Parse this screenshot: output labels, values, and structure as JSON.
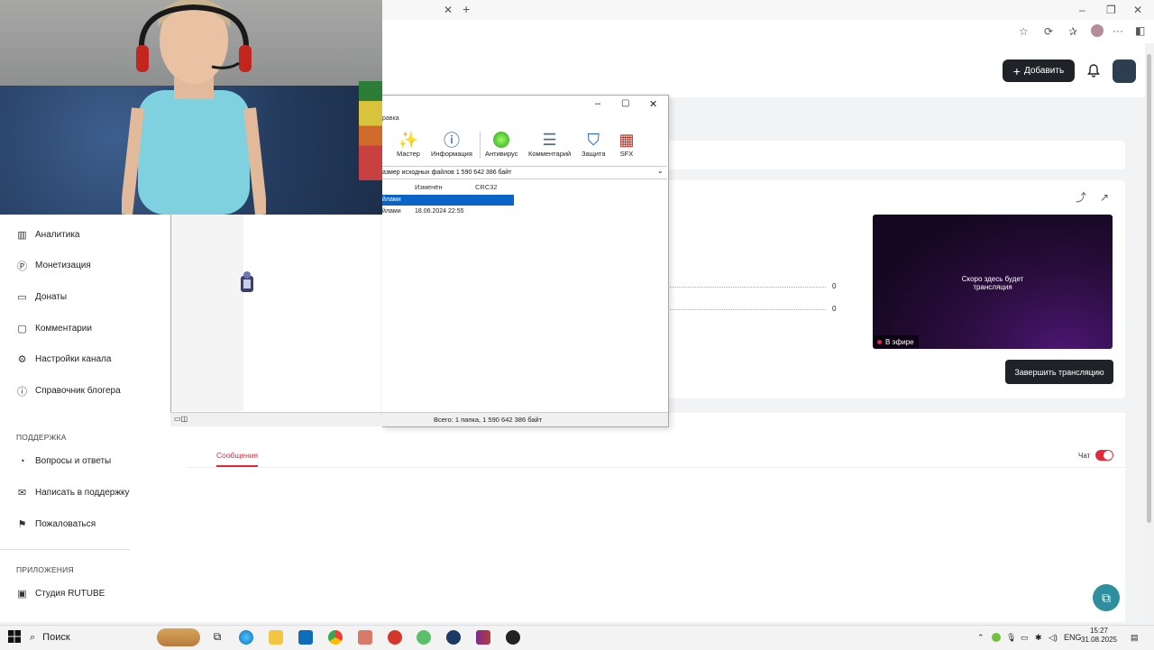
{
  "browser": {
    "tab_close": "✕",
    "tab_new": "+",
    "window_controls": [
      "–",
      "❐",
      "✕"
    ]
  },
  "header": {
    "add_button_label": "Добавить"
  },
  "sidebar": {
    "items": [
      {
        "label": "Аналитика",
        "icon": "analytics-icon"
      },
      {
        "label": "Монетизация",
        "icon": "monetization-icon"
      },
      {
        "label": "Донаты",
        "icon": "donations-icon"
      },
      {
        "label": "Комментарии",
        "icon": "comments-icon"
      },
      {
        "label": "Настройки канала",
        "icon": "settings-icon"
      },
      {
        "label": "Справочник блогера",
        "icon": "info-icon"
      }
    ],
    "support_section": "ПОДДЕРЖКА",
    "support_items": [
      {
        "label": "Вопросы и ответы",
        "icon": "faq-icon"
      },
      {
        "label": "Написать в поддержку",
        "icon": "mail-icon"
      },
      {
        "label": "Пожаловаться",
        "icon": "flag-icon"
      }
    ],
    "apps_section": "ПРИЛОЖЕНИЯ",
    "apps_items": [
      {
        "label": "Студия RUTUBE",
        "icon": "studio-icon"
      }
    ]
  },
  "stream": {
    "preview_text": "Скоро здесь будет трансляция",
    "live_badge": "В эфире",
    "end_button": "Завершить трансляцию",
    "stat_values": [
      "0",
      "0"
    ]
  },
  "chat": {
    "tab_messages": "Сообщения",
    "chat_label": "Чат",
    "chat_enabled": true
  },
  "archiver": {
    "menu_fragment": "равка",
    "toolbar": [
      {
        "label": "Мастер",
        "icon": "wand-icon"
      },
      {
        "label": "Информация",
        "icon": "info-icon"
      },
      {
        "label": "Антивирус",
        "icon": "antivirus-icon"
      },
      {
        "label": "Комментарий",
        "icon": "comment-icon"
      },
      {
        "label": "Защита",
        "icon": "shield-icon"
      },
      {
        "label": "SFX",
        "icon": "sfx-icon"
      }
    ],
    "path_text": "азмер исходных файлов 1 590 642 386 байт",
    "columns": [
      "Изменён",
      "CRC32"
    ],
    "rows": [
      {
        "name": "йлами",
        "modified": "",
        "selected": true
      },
      {
        "name": "йлами",
        "modified": "18.06.2024 22:55",
        "selected": false
      }
    ],
    "status": "Всего: 1 папка, 1 590 642 386 байт"
  },
  "taskbar": {
    "search_placeholder": "Поиск",
    "tray_lang": "ENG",
    "time": "15:27",
    "date": "31.08.2025"
  }
}
